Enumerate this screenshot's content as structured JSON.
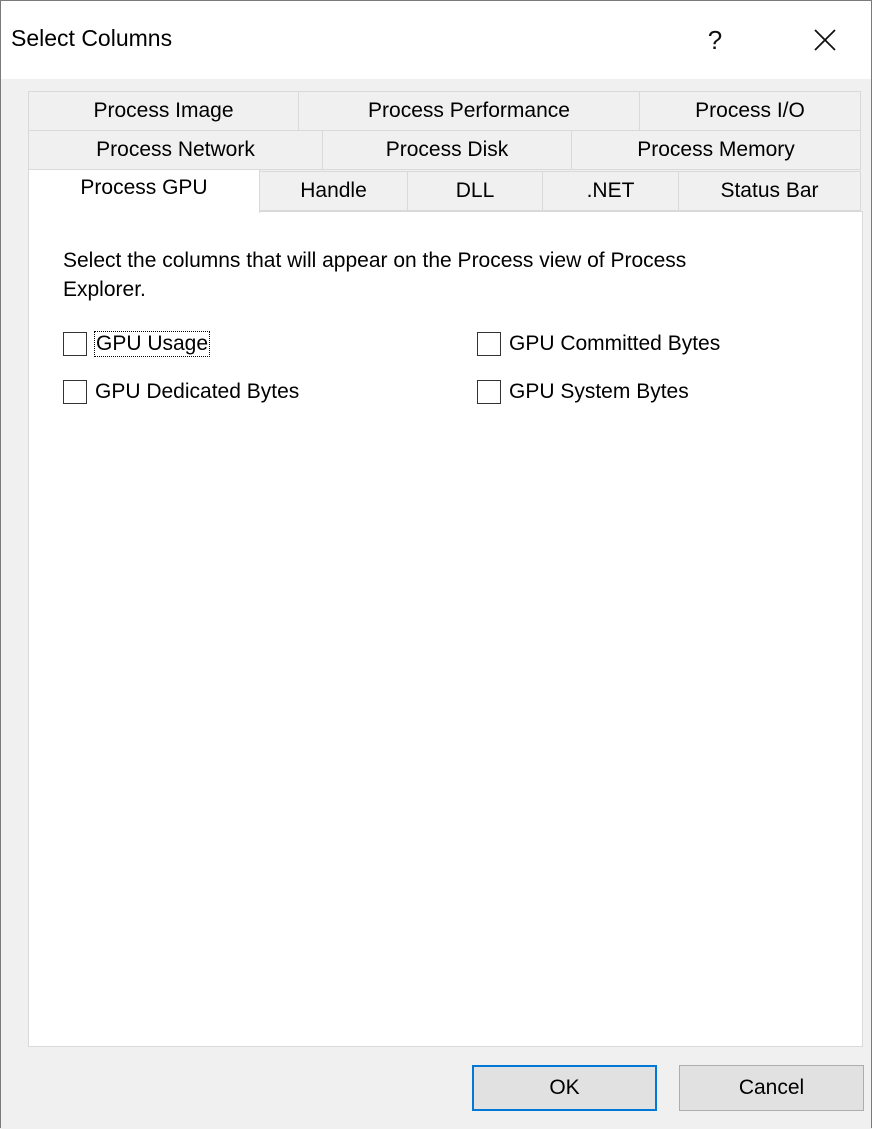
{
  "window": {
    "title": "Select Columns",
    "help_label": "?"
  },
  "tabs": {
    "row1": [
      {
        "label": "Process Image"
      },
      {
        "label": "Process Performance"
      },
      {
        "label": "Process I/O"
      }
    ],
    "row2": [
      {
        "label": "Process Network"
      },
      {
        "label": "Process Disk"
      },
      {
        "label": "Process Memory"
      }
    ],
    "row3": [
      {
        "label": "Process GPU",
        "active": true
      },
      {
        "label": "Handle"
      },
      {
        "label": "DLL"
      },
      {
        "label": ".NET"
      },
      {
        "label": "Status Bar"
      }
    ]
  },
  "panel": {
    "description": "Select the columns that will appear on the Process view of Process Explorer.",
    "checkboxes": [
      {
        "label": "GPU Usage",
        "checked": false
      },
      {
        "label": "GPU Committed Bytes",
        "checked": false
      },
      {
        "label": "GPU Dedicated Bytes",
        "checked": false
      },
      {
        "label": "GPU System Bytes",
        "checked": false
      }
    ]
  },
  "buttons": {
    "ok_label": "OK",
    "cancel_label": "Cancel"
  }
}
